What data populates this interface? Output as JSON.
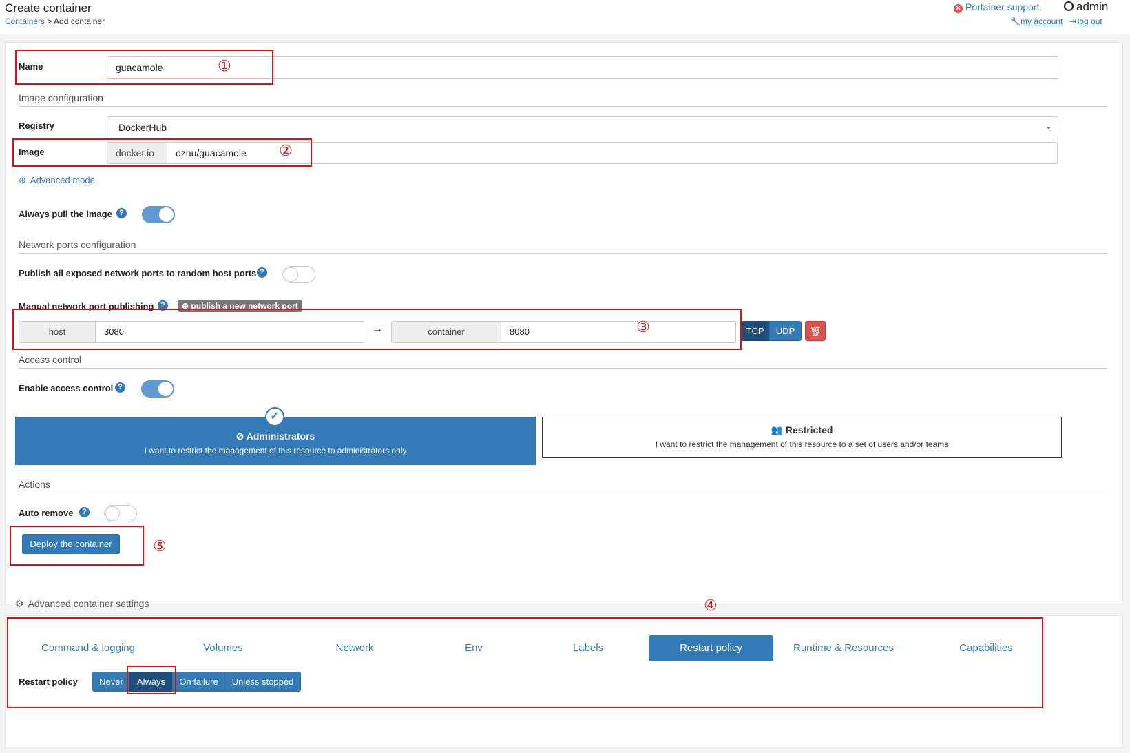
{
  "header": {
    "title": "Create container",
    "breadcrumb_link": "Containers",
    "breadcrumb_sep": " > ",
    "breadcrumb_current": "Add container",
    "support": "Portainer support",
    "user": "admin",
    "my_account": "my account",
    "log_out": "log out"
  },
  "form": {
    "name_label": "Name",
    "name_value": "guacamole",
    "image_config_title": "Image configuration",
    "registry_label": "Registry",
    "registry_value": "DockerHub",
    "image_label": "Image",
    "image_prefix": "docker.io",
    "image_value": "oznu/guacamole",
    "advanced_mode": "Advanced mode",
    "always_pull_label": "Always pull the image",
    "always_pull_on": true,
    "network_title": "Network ports configuration",
    "publish_all_label": "Publish all exposed network ports to random host ports",
    "publish_all_on": false,
    "manual_publish_label": "Manual network port publishing",
    "publish_new_button": "publish a new network port",
    "host_addon": "host",
    "host_port": "3080",
    "arrow": "→",
    "container_addon": "container",
    "container_port": "8080",
    "tcp": "TCP",
    "udp": "UDP",
    "access_title": "Access control",
    "enable_access_label": "Enable access control",
    "enable_access_on": true,
    "admin_title": "Administrators",
    "admin_desc": "I want to restrict the management of this resource to administrators only",
    "restricted_title": "Restricted",
    "restricted_desc": "I want to restrict the management of this resource to a set of users and/or teams",
    "actions_title": "Actions",
    "auto_remove_label": "Auto remove",
    "auto_remove_on": false,
    "deploy_button": "Deploy the container"
  },
  "annotations": {
    "n1": "①",
    "n2": "②",
    "n3": "③",
    "n4": "④",
    "n5": "⑤"
  },
  "advanced": {
    "title": "Advanced container settings",
    "tabs": [
      {
        "label": "Command & logging"
      },
      {
        "label": "Volumes"
      },
      {
        "label": "Network"
      },
      {
        "label": "Env"
      },
      {
        "label": "Labels"
      },
      {
        "label": "Restart policy",
        "active": true
      },
      {
        "label": "Runtime & Resources"
      },
      {
        "label": "Capabilities"
      }
    ],
    "restart_label": "Restart policy",
    "restart_options": [
      "Never",
      "Always",
      "On failure",
      "Unless stopped"
    ],
    "restart_selected": "Always"
  },
  "colors": {
    "primary": "#337ab7",
    "danger": "#d9534f",
    "annotation": "#e01010"
  }
}
